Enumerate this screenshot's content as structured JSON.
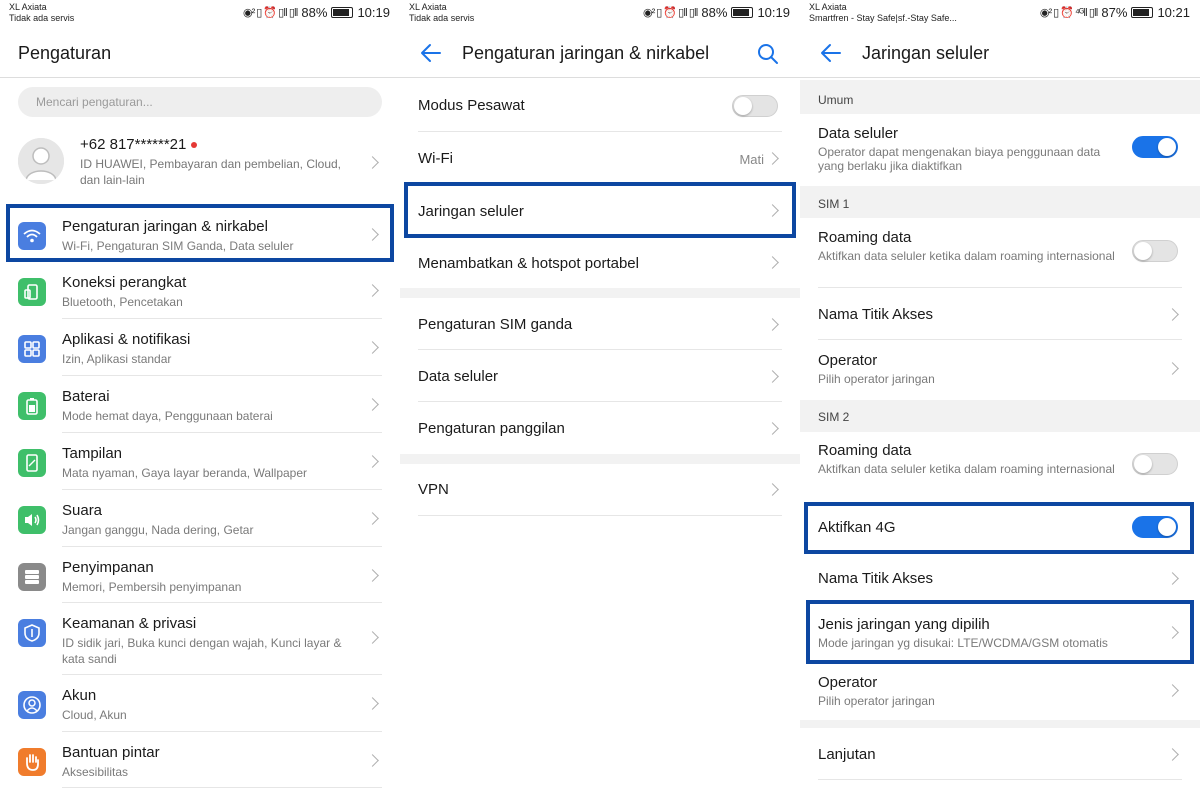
{
  "colors": {
    "accent": "#1a73e8",
    "highlight": "#0d47a1",
    "notif_dot": "#e53935"
  },
  "panel1": {
    "status": {
      "carrier": "XL Axiata",
      "service": "Tidak ada servis",
      "battery": "88%",
      "time": "10:19",
      "icons": "◉² ▯ ⏰ ▯‖ ▯‖"
    },
    "title": "Pengaturan",
    "search_placeholder": "Mencari pengaturan...",
    "account": {
      "name": "+62 817******21",
      "sub": "ID HUAWEI, Pembayaran dan pembelian, Cloud, dan lain-lain"
    },
    "items": [
      {
        "label": "Pengaturan jaringan & nirkabel",
        "sub": "Wi-Fi, Pengaturan SIM Ganda, Data seluler",
        "icon": "wifi-icon",
        "color": "#4a7ee0"
      },
      {
        "label": "Koneksi perangkat",
        "sub": "Bluetooth, Pencetakan",
        "icon": "device-connect-icon",
        "color": "#3fbf6a"
      },
      {
        "label": "Aplikasi & notifikasi",
        "sub": "Izin, Aplikasi standar",
        "icon": "apps-grid-icon",
        "color": "#4a7ee0"
      },
      {
        "label": "Baterai",
        "sub": "Mode hemat daya, Penggunaan baterai",
        "icon": "battery-icon",
        "color": "#3fbf6a"
      },
      {
        "label": "Tampilan",
        "sub": "Mata nyaman, Gaya layar beranda, Wallpaper",
        "icon": "display-icon",
        "color": "#3fbf6a"
      },
      {
        "label": "Suara",
        "sub": "Jangan ganggu, Nada dering, Getar",
        "icon": "speaker-icon",
        "color": "#3fbf6a"
      },
      {
        "label": "Penyimpanan",
        "sub": "Memori, Pembersih penyimpanan",
        "icon": "storage-icon",
        "color": "#8a8a8a"
      },
      {
        "label": "Keamanan & privasi",
        "sub": "ID sidik jari, Buka kunci dengan wajah, Kunci layar & kata sandi",
        "icon": "shield-icon",
        "color": "#4a7ee0"
      },
      {
        "label": "Akun",
        "sub": "Cloud, Akun",
        "icon": "account-icon",
        "color": "#4a7ee0"
      },
      {
        "label": "Bantuan pintar",
        "sub": "Aksesibilitas",
        "icon": "hand-icon",
        "color": "#f07c2c"
      }
    ]
  },
  "panel2": {
    "status": {
      "carrier": "XL Axiata",
      "service": "Tidak ada servis",
      "battery": "88%",
      "time": "10:19",
      "icons": "◉² ▯ ⏰ ▯‖ ▯‖"
    },
    "title": "Pengaturan jaringan & nirkabel",
    "items": [
      {
        "label": "Modus Pesawat"
      },
      {
        "label": "Wi-Fi",
        "value": "Mati"
      },
      {
        "label": "Jaringan seluler"
      },
      {
        "label": "Menambatkan & hotspot portabel"
      },
      {
        "label": "Pengaturan SIM ganda"
      },
      {
        "label": "Data seluler"
      },
      {
        "label": "Pengaturan panggilan"
      },
      {
        "label": "VPN"
      }
    ]
  },
  "panel3": {
    "status": {
      "carrier": "XL Axiata",
      "service": "Smartfren - Stay Safe|sf.-Stay Safe...",
      "battery": "87%",
      "time": "10:21",
      "icons": "◉² ▯ ⏰ ⁴ᴳ‖ ▯‖"
    },
    "title": "Jaringan seluler",
    "sections": {
      "umum": "Umum",
      "sim1": "SIM 1",
      "sim2": "SIM 2"
    },
    "data_seluler": {
      "label": "Data seluler",
      "sub": "Operator dapat mengenakan biaya penggunaan data yang berlaku jika diaktifkan"
    },
    "sim1_roaming": {
      "label": "Roaming data",
      "sub": "Aktifkan data seluler ketika dalam roaming internasional"
    },
    "sim1_apn": {
      "label": "Nama Titik Akses"
    },
    "sim1_operator": {
      "label": "Operator",
      "sub": "Pilih operator jaringan"
    },
    "sim2_roaming": {
      "label": "Roaming data",
      "sub": "Aktifkan data seluler ketika dalam roaming internasional"
    },
    "sim2_4g": {
      "label": "Aktifkan 4G"
    },
    "sim2_apn": {
      "label": "Nama Titik Akses"
    },
    "sim2_network": {
      "label": "Jenis jaringan yang dipilih",
      "sub": "Mode jaringan yg disukai: LTE/WCDMA/GSM otomatis"
    },
    "sim2_operator": {
      "label": "Operator",
      "sub": "Pilih operator jaringan"
    },
    "lanjutan": {
      "label": "Lanjutan"
    }
  }
}
